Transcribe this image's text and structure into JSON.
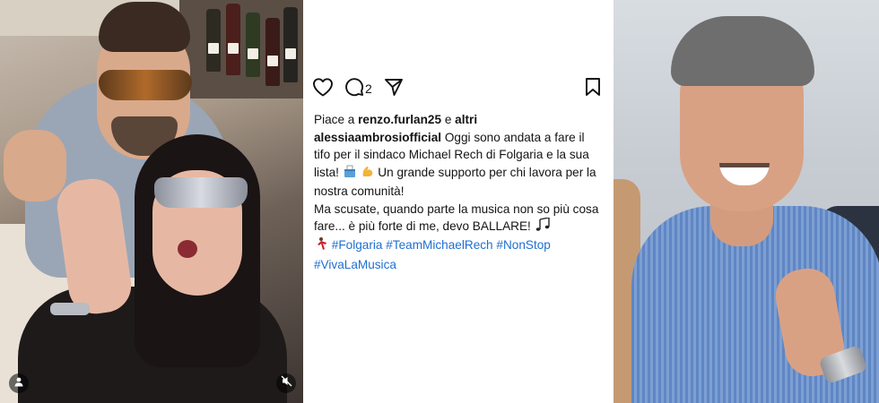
{
  "post": {
    "comment_count": "2",
    "likes": {
      "prefix": "Piace a ",
      "user": "renzo.furlan25",
      "middle": " e ",
      "others": "altri"
    },
    "caption": {
      "username": "alessiaambrosiofficial",
      "text1": " Oggi sono andata a fare il tifo per il sindaco Michael Rech di Folgaria e la sua lista! ",
      "text2": " Un grande supporto per chi lavora per la nostra comunità!",
      "text3": "Ma scusate, quando parte la musica non so più cosa fare... è più forte di me, devo BALLARE! ",
      "hashtags": [
        "#Folgaria",
        "#TeamMichaelRech",
        "#NonStop",
        "#VivaLaMusica"
      ]
    }
  },
  "icons": {
    "like": "heart-icon",
    "comment": "comment-icon",
    "share": "send-icon",
    "save": "bookmark-icon",
    "profile": "person-icon",
    "mute": "speaker-muted-icon",
    "ballot": "ballot-box-emoji",
    "muscle": "flexed-biceps-emoji",
    "notes": "music-notes-emoji",
    "dancer": "dancer-emoji"
  },
  "colors": {
    "hashtag": "#1f6fd0",
    "text": "#141414"
  }
}
